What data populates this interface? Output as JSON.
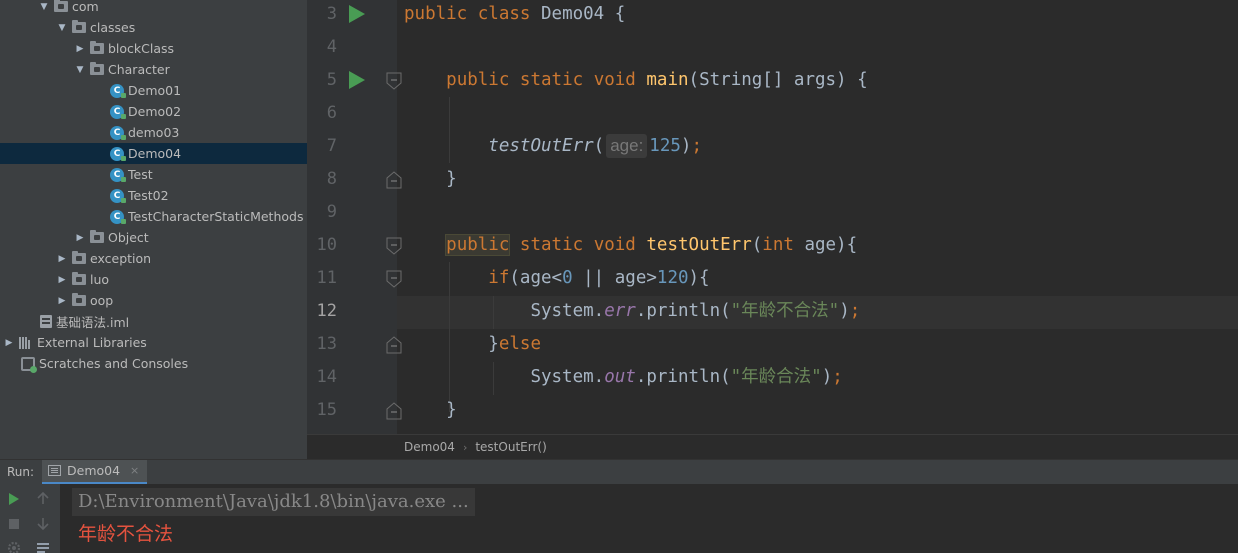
{
  "project_tree": {
    "rows": [
      {
        "label": "com",
        "type": "package",
        "expanded": true
      },
      {
        "label": "classes",
        "type": "package",
        "expanded": true
      },
      {
        "label": "blockClass",
        "type": "package",
        "expanded": false
      },
      {
        "label": "Character",
        "type": "package",
        "expanded": true
      },
      {
        "label": "Demo01",
        "type": "class"
      },
      {
        "label": "Demo02",
        "type": "class"
      },
      {
        "label": "demo03",
        "type": "class"
      },
      {
        "label": "Demo04",
        "type": "class",
        "selected": true
      },
      {
        "label": "Test",
        "type": "class"
      },
      {
        "label": "Test02",
        "type": "class"
      },
      {
        "label": "TestCharacterStaticMethods",
        "type": "class"
      },
      {
        "label": "Object",
        "type": "package",
        "expanded": false
      },
      {
        "label": "exception",
        "type": "package",
        "expanded": false
      },
      {
        "label": "luo",
        "type": "package",
        "expanded": false
      },
      {
        "label": "oop",
        "type": "package",
        "expanded": false
      },
      {
        "label": "基础语法.iml",
        "type": "iml"
      },
      {
        "label": "External Libraries",
        "type": "library",
        "expanded": false
      },
      {
        "label": "Scratches and Consoles",
        "type": "scratches"
      }
    ]
  },
  "editor": {
    "current_line": "12",
    "line_numbers": [
      "3",
      "4",
      "5",
      "6",
      "7",
      "8",
      "9",
      "10",
      "11",
      "12",
      "13",
      "14",
      "15"
    ],
    "tokens": {
      "l3_public": "public",
      "l3_class": "class",
      "l3_name": "Demo04",
      "l3_brace": "{",
      "l5_public": "public",
      "l5_static": "static",
      "l5_void": "void",
      "l5_main": "main",
      "l5_params": "(String[] args) {",
      "l7_call": "testOutErr",
      "l7_open": "(",
      "l7_hint": "age:",
      "l7_num": "125",
      "l7_close": ")",
      "l7_semi": ";",
      "l8_brace": "}",
      "l10_public": "public",
      "l10_static": "static",
      "l10_void": "void",
      "l10_name": "testOutErr",
      "l10_open": "(",
      "l10_int": "int",
      "l10_rest": " age){",
      "l11_if": "if",
      "l11_a": "(age<",
      "l11_zero": "0",
      "l11_b": " || age>",
      "l11_120": "120",
      "l11_c": "){",
      "l12_sys": "System.",
      "l12_err": "err",
      "l12_print": ".println(",
      "l12_str": "\"年龄不合法\"",
      "l12_close": ")",
      "l12_semi": ";",
      "l13_brace": "}",
      "l13_else": "else",
      "l14_sys": "System.",
      "l14_out": "out",
      "l14_print": ".println(",
      "l14_str": "\"年龄合法\"",
      "l14_close": ")",
      "l14_semi": ";",
      "l15_brace": "}"
    }
  },
  "breadcrumb": [
    "Demo04",
    "testOutErr()"
  ],
  "run_panel": {
    "label": "Run:",
    "tab": "Demo04",
    "tab_close": "×",
    "console_lines": [
      {
        "text": "D:\\Environment\\Java\\jdk1.8\\bin\\java.exe ...",
        "kind": "command"
      },
      {
        "text": "年龄不合法",
        "kind": "stderr"
      }
    ]
  }
}
